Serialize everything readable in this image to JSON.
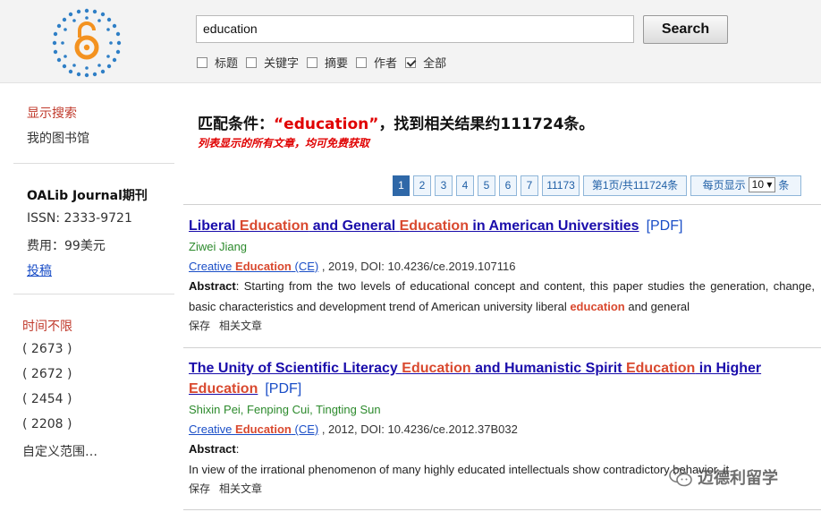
{
  "search": {
    "value": "education",
    "button": "Search",
    "filters": [
      {
        "label": "标题",
        "checked": false
      },
      {
        "label": "关键字",
        "checked": false
      },
      {
        "label": "摘要",
        "checked": false
      },
      {
        "label": "作者",
        "checked": false
      },
      {
        "label": "全部",
        "checked": true
      }
    ]
  },
  "sidebar": {
    "show_search": "显示搜索",
    "my_library": "我的图书馆",
    "journal_title": "OALib Journal期刊",
    "issn": "ISSN: 2333-9721",
    "fee": "费用：99美元",
    "submit": "投稿",
    "time_label": "时间不限",
    "counts": [
      "( 2673 )",
      "( 2672 )",
      "( 2454 )",
      "( 2208 )"
    ],
    "custom_range": "自定义范围…"
  },
  "summary": {
    "prefix": "匹配条件：",
    "keyword": "“education”",
    "suffix": "，找到相关结果约111724条。",
    "note": "列表显示的所有文章，均可免费获取"
  },
  "pager": {
    "pages": [
      "1",
      "2",
      "3",
      "4",
      "5",
      "6",
      "7",
      "11173"
    ],
    "active": "1",
    "page_info": "第1页/共111724条",
    "per_page_label": "每页显示",
    "per_page_value": "10 ▾",
    "per_page_unit": "条"
  },
  "results": [
    {
      "title_parts": [
        "Liberal ",
        "Education",
        " and General ",
        "Education",
        " in American Universities"
      ],
      "pdf": "[PDF]",
      "authors": "Ziwei Jiang",
      "journal_pre": "Creative ",
      "journal_hl": "Education",
      "journal_post": " (CE)",
      "meta": " , 2019, DOI: 10.4236/ce.2019.107116",
      "abstract_label": "Abstract",
      "abstract_text": ": Starting from the two levels of educational concept and content, this paper studies the generation, change, basic characteristics and development trend of American university liberal ",
      "abstract_hl": "education",
      "abstract_tail": " and general",
      "save": "保存",
      "related": "相关文章"
    },
    {
      "title_parts": [
        "The Unity of Scientific Literacy ",
        "Education",
        " and Humanistic Spirit ",
        "Education",
        " in Higher ",
        "Education"
      ],
      "pdf": "[PDF]",
      "authors": "Shixin Pei, Fenping Cui, Tingting Sun",
      "journal_pre": "Creative ",
      "journal_hl": "Education",
      "journal_post": " (CE)",
      "meta": " , 2012, DOI: 10.4236/ce.2012.37B032",
      "abstract_label": "Abstract",
      "abstract_colon": ":",
      "abstract_text2": "In view of the irrational phenomenon of many highly educated intellectuals show",
      "abstract_text2b": "contradictory behavior, it",
      "save": "保存",
      "related": "相关文章"
    }
  ],
  "watermark": "迈德利留学"
}
